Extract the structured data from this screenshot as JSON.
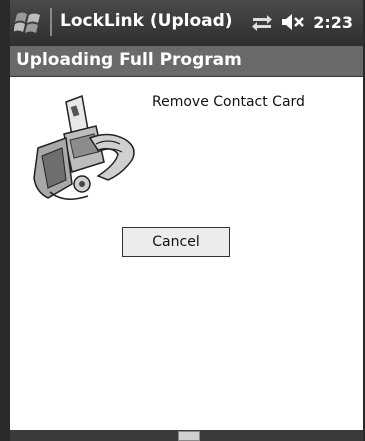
{
  "titlebar": {
    "app_title": "LockLink (Upload)",
    "clock": "2:23",
    "icons": [
      "windows-start-icon",
      "connectivity-icon",
      "volume-muted-icon"
    ]
  },
  "header": {
    "title": "Uploading Full Program"
  },
  "main": {
    "instruction": "Remove Contact Card",
    "illustration": "contact-card-reader-image",
    "cancel_label": "Cancel"
  },
  "menubar": {
    "icons": [
      "keyboard-icon"
    ]
  },
  "colors": {
    "titlebar_bg": "#2e2e2e",
    "header_bg": "#6a6a6a",
    "content_bg": "#ffffff",
    "button_bg": "#ececec"
  }
}
